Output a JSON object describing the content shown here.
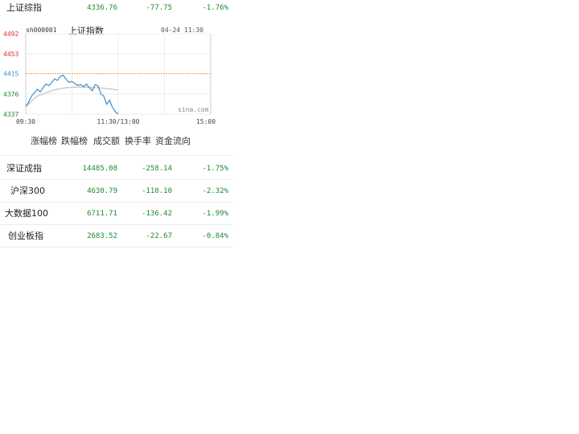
{
  "top_row": {
    "name": "上证综指",
    "price": "4336.76",
    "change": "-77.75",
    "percent": "-1.76%"
  },
  "chart": {
    "code": "sh000001",
    "name": "上证指数",
    "datetime": "04-24 11:30",
    "watermark": "sina.com",
    "y_ticks": [
      "4492",
      "4453",
      "4415",
      "4376",
      "4337"
    ],
    "x_ticks": [
      "09:30",
      "11:30/13:00",
      "15:00"
    ],
    "colors": {
      "up": "#e03030",
      "down": "#1a8a2a",
      "price_line": "#3d8ecf",
      "avg_line": "#c8c8c8",
      "ref_line": "#f0a040"
    }
  },
  "chart_data": {
    "type": "line",
    "ylim": [
      4337,
      4492
    ],
    "reference": 4415,
    "series": [
      {
        "values": [
          4352,
          4360,
          4372,
          4378,
          4385,
          4380,
          4388,
          4395,
          4392,
          4398,
          4405,
          4402,
          4410,
          4412,
          4404,
          4398,
          4400,
          4396,
          4392,
          4394,
          4390,
          4395,
          4388,
          4382,
          4394,
          4392,
          4376,
          4372,
          4356,
          4364,
          4350,
          4342,
          4337
        ]
      },
      {
        "values": [
          4352,
          4356,
          4362,
          4367,
          4372,
          4374,
          4376,
          4378,
          4380,
          4382,
          4384,
          4385,
          4386,
          4387,
          4388,
          4388,
          4389,
          4389,
          4389,
          4389,
          4389,
          4389,
          4389,
          4388,
          4388,
          4388,
          4387,
          4387,
          4386,
          4386,
          4385,
          4384,
          4384
        ]
      }
    ]
  },
  "tabs": [
    "涨幅榜",
    "跌幅榜",
    "成交额",
    "换手率",
    "资金流向"
  ],
  "indices": [
    {
      "name": "深证成指",
      "price": "14485.08",
      "change": "-258.14",
      "percent": "-1.75%"
    },
    {
      "name": "沪深300",
      "price": "4630.79",
      "change": "-110.10",
      "percent": "-2.32%"
    },
    {
      "name": "大数据100",
      "price": "6711.71",
      "change": "-136.42",
      "percent": "-1.99%"
    },
    {
      "name": "创业板指",
      "price": "2683.52",
      "change": "-22.67",
      "percent": "-0.84%"
    }
  ]
}
